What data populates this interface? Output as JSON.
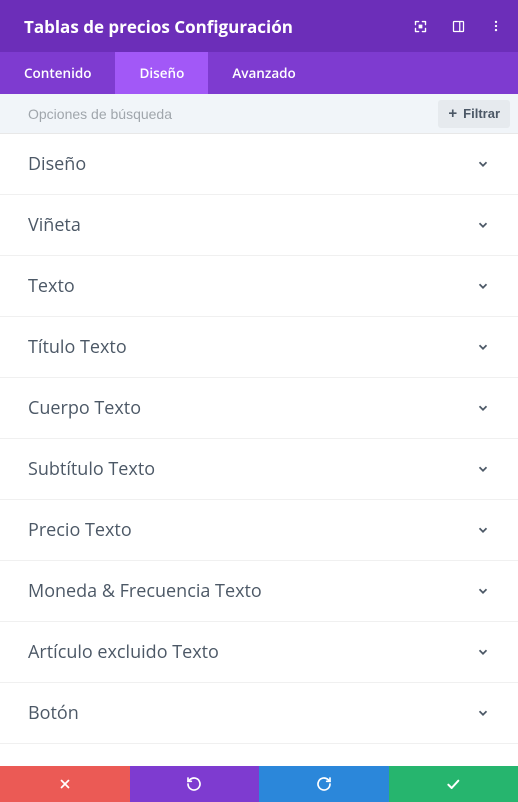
{
  "header": {
    "title": "Tablas de precios Configuración"
  },
  "tabs": {
    "content": "Contenido",
    "design": "Diseño",
    "advanced": "Avanzado",
    "active": "design"
  },
  "search": {
    "placeholder": "Opciones de búsqueda",
    "filter_label": "Filtrar"
  },
  "sections": [
    {
      "label": "Diseño"
    },
    {
      "label": "Viñeta"
    },
    {
      "label": "Texto"
    },
    {
      "label": "Título Texto"
    },
    {
      "label": "Cuerpo Texto"
    },
    {
      "label": "Subtítulo Texto"
    },
    {
      "label": "Precio Texto"
    },
    {
      "label": "Moneda & Frecuencia Texto"
    },
    {
      "label": "Artículo excluido Texto"
    },
    {
      "label": "Botón"
    }
  ]
}
